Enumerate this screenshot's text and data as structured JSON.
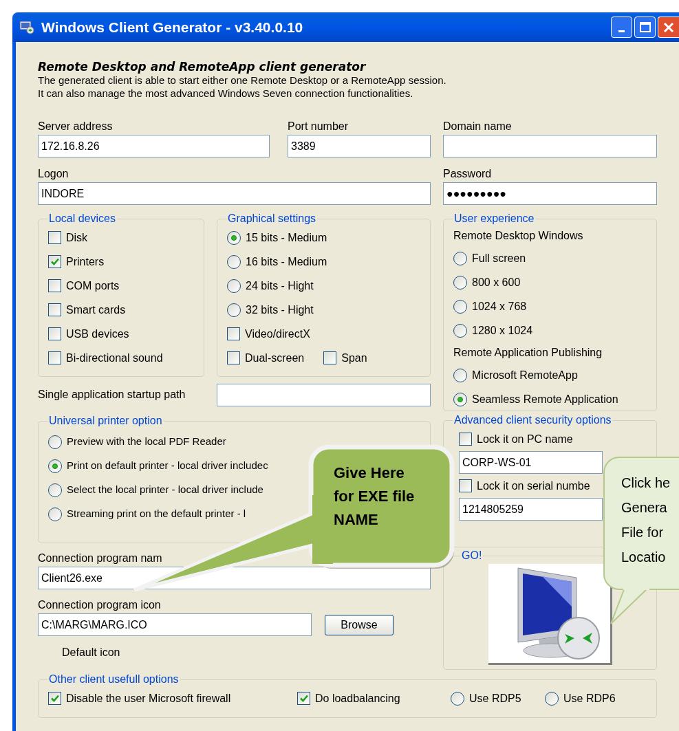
{
  "window": {
    "title": "Windows Client Generator - v3.40.0.10"
  },
  "header": {
    "title": "Remote Desktop and RemoteApp client generator",
    "lines": [
      "The generated client is able to start either one Remote Desktop or a RemoteApp session.",
      "It can also manage the most advanced Windows Seven connection functionalities."
    ]
  },
  "server_address": {
    "label": "Server address",
    "value": "172.16.8.26"
  },
  "port_number": {
    "label": "Port number",
    "value": "3389"
  },
  "domain_name": {
    "label": "Domain name"
  },
  "logon": {
    "label": "Logon",
    "value": "INDORE"
  },
  "password": {
    "label": "Password",
    "value": "●●●●●●●●●"
  },
  "local_devices": {
    "title": "Local devices",
    "items": [
      {
        "label": "Disk",
        "checked": false
      },
      {
        "label": "Printers",
        "checked": true
      },
      {
        "label": "COM ports",
        "checked": false
      },
      {
        "label": "Smart cards",
        "checked": false
      },
      {
        "label": "USB devices",
        "checked": false
      },
      {
        "label": "Bi-directional sound",
        "checked": false
      }
    ]
  },
  "graphical_settings": {
    "title": "Graphical settings",
    "items": [
      {
        "kind": "radio",
        "label": "15 bits - Medium",
        "selected": true
      },
      {
        "kind": "radio",
        "label": "16 bits - Medium",
        "selected": false
      },
      {
        "kind": "radio",
        "label": "24 bits - Hight",
        "selected": false
      },
      {
        "kind": "radio",
        "label": "32 bits - Hight",
        "selected": false
      },
      {
        "kind": "checkbox",
        "label": "Video/directX",
        "checked": false
      }
    ],
    "extras": [
      {
        "label": "Dual-screen",
        "checked": false
      },
      {
        "label": "Span",
        "checked": false
      }
    ]
  },
  "user_experience": {
    "title": "User experience",
    "sections": [
      {
        "heading": "Remote Desktop Windows",
        "options": [
          {
            "label": "Full screen",
            "selected": false
          },
          {
            "label": "800 x 600",
            "selected": false
          },
          {
            "label": "1024 x 768",
            "selected": false
          },
          {
            "label": "1280 x 1024",
            "selected": false
          }
        ]
      },
      {
        "heading": "Remote Application Publishing",
        "options": [
          {
            "label": "Microsoft RemoteApp",
            "selected": false
          },
          {
            "label": "Seamless Remote Application",
            "selected": true
          }
        ]
      }
    ]
  },
  "startup_path": {
    "label": "Single application startup path"
  },
  "universal_printer": {
    "title": "Universal printer option",
    "options": [
      {
        "label": "Preview with the local PDF Reader",
        "selected": false
      },
      {
        "label": "Print on default printer - local driver includec",
        "selected": true
      },
      {
        "label": "Select the local printer - local driver include",
        "selected": false
      },
      {
        "label": "Streaming print on the default printer - l",
        "selected": false
      }
    ]
  },
  "security": {
    "title": "Advanced client security options",
    "items": [
      {
        "kind": "checkbox",
        "label": "Lock it on PC name",
        "checked": false
      },
      {
        "kind": "field",
        "value": "CORP-WS-01"
      },
      {
        "kind": "checkbox",
        "label": "Lock it on serial numbe",
        "checked": false
      },
      {
        "kind": "field",
        "value": "1214805259"
      }
    ]
  },
  "go": {
    "title": "GO!"
  },
  "program_name": {
    "label": "Connection program nam",
    "value": "Client26.exe"
  },
  "program_icon": {
    "label": "Connection program icon",
    "value": "C:\\MARG\\MARG.ICO",
    "button": "Browse",
    "note": "Default icon"
  },
  "other_options": {
    "title": "Other client usefull options",
    "items": [
      {
        "kind": "checkbox",
        "label": "Disable the user Microsoft firewall",
        "checked": true
      },
      {
        "kind": "checkbox",
        "label": "Do loadbalancing",
        "checked": true
      },
      {
        "kind": "radio",
        "label": "Use RDP5",
        "selected": false
      },
      {
        "kind": "radio",
        "label": "Use RDP6",
        "selected": false
      }
    ]
  },
  "callouts": [
    {
      "kind": "dark",
      "lines": [
        "Give Here",
        "for EXE file",
        "NAME"
      ]
    },
    {
      "kind": "light",
      "lines": [
        "Click he",
        "Genera",
        "File for",
        "Locatio"
      ]
    }
  ]
}
